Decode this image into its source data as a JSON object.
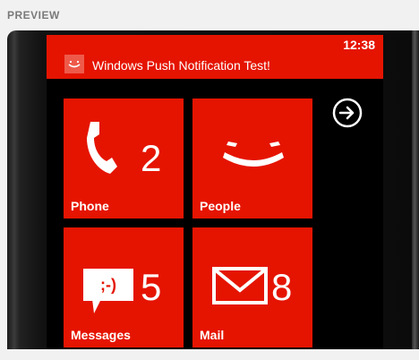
{
  "preview_label": "PREVIEW",
  "status_bar": {
    "time": "12:38"
  },
  "toast": {
    "title": "Windows Push Notification Test!",
    "icon": "smiley-app-icon"
  },
  "tiles": [
    {
      "label": "Phone",
      "count": "2",
      "icon": "phone-icon"
    },
    {
      "label": "People",
      "count": "",
      "icon": "smiley-face-icon"
    },
    {
      "label": "Messages",
      "count": "5",
      "icon": "message-bubble-icon"
    },
    {
      "label": "Mail",
      "count": "8",
      "icon": "mail-icon"
    }
  ],
  "colors": {
    "accent": "#e51400",
    "background": "#000000",
    "page": "#f1f1f1"
  },
  "nav": {
    "icon": "arrow-right-circle-icon"
  }
}
